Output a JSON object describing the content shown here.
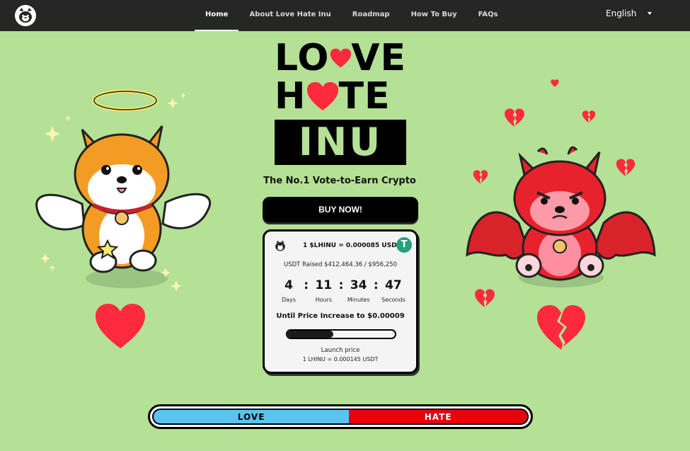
{
  "nav": {
    "items": [
      {
        "label": "Home",
        "active": true
      },
      {
        "label": "About Love Hate Inu",
        "active": false
      },
      {
        "label": "Roadmap",
        "active": false
      },
      {
        "label": "How To Buy",
        "active": false
      },
      {
        "label": "FAQs",
        "active": false
      }
    ],
    "language": "English"
  },
  "title": {
    "line1_prefix": "LO",
    "line1_suffix": "VE",
    "line2_prefix": "H",
    "line2_suffix": "TE",
    "line3": "INU"
  },
  "tagline": "The No.1 Vote-to-Earn Crypto",
  "buy_button": "BUY NOW!",
  "presale": {
    "rate": "1 $LHINU = 0.000085 USDT",
    "tether_symbol": "T",
    "raised": "USDT Raised $412,464.36 / $956,250",
    "timer": {
      "days": "4",
      "days_label": "Days",
      "hours": "11",
      "hours_label": "Hours",
      "minutes": "34",
      "minutes_label": "Minutes",
      "seconds": "47",
      "seconds_label": "Seconds",
      "separator": ":"
    },
    "until": "Until Price Increase to $0.00009",
    "progress_fraction": 0.43,
    "launch_label": "Launch price",
    "launch_price": "1 LHINU = 0.000145 USDT"
  },
  "vote": {
    "love": "LOVE",
    "hate": "HATE",
    "love_fraction": 0.523
  },
  "colors": {
    "background": "#b4e195",
    "nav": "#262626",
    "love_blue": "#5cc2f5",
    "hate_red": "#e8000b",
    "heart_red": "#ff2a3d",
    "tether_green": "#26a17b"
  },
  "icons": [
    "dog-logo-icon",
    "caret-down-icon",
    "heart-icon",
    "tether-icon",
    "angel-dog-mascot",
    "devil-dog-mascot",
    "broken-heart-icon",
    "sparkle-icon"
  ]
}
